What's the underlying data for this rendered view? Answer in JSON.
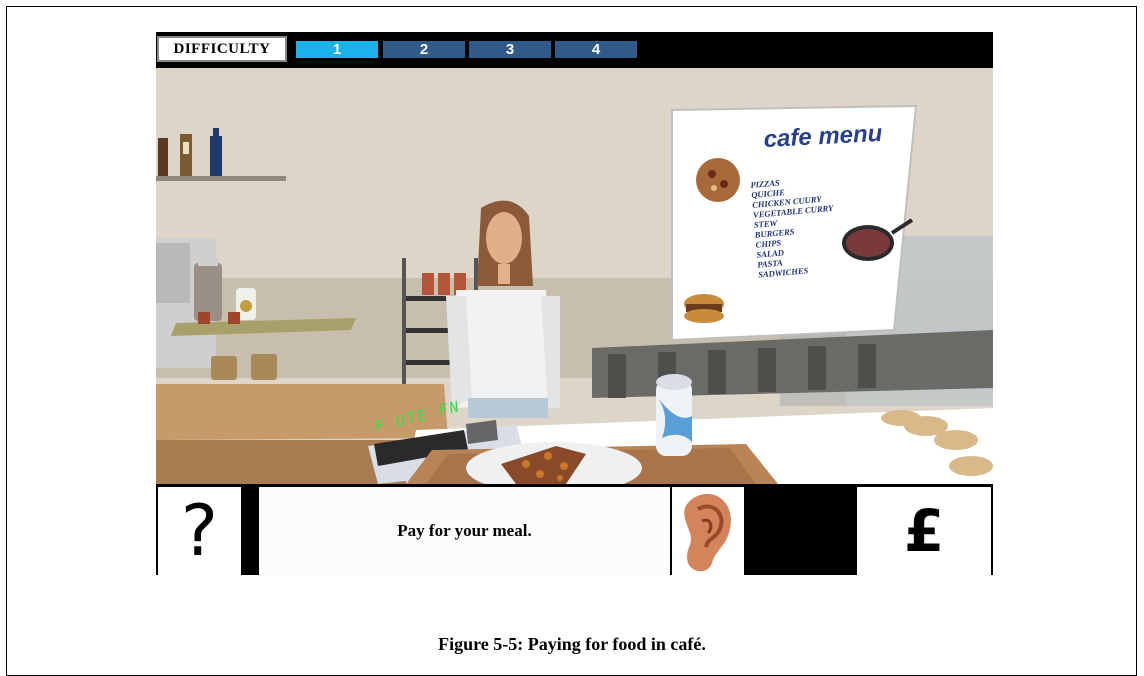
{
  "difficulty": {
    "label": "DIFFICULTY",
    "levels": [
      "1",
      "2",
      "3",
      "4"
    ],
    "selected": "1",
    "colors": {
      "selected": "#1ab2ea",
      "unselected": "#2f5a8a"
    }
  },
  "menu": {
    "title": "cafe menu",
    "items": [
      "PIZZAS",
      "QUICHE",
      "CHICKEN CUURY",
      "VEGETABLE CURRY",
      "STEW",
      "BURGERS",
      "CHIPS",
      "SALAD",
      "PASTA",
      "SADWICHES"
    ]
  },
  "till_display": "F UTE FN",
  "toolbar": {
    "help_symbol": "?",
    "message": "Pay for your meal.",
    "ear_icon": "ear-icon",
    "pay_symbol": "£"
  },
  "caption": "Figure 5-5: Paying for food in café."
}
